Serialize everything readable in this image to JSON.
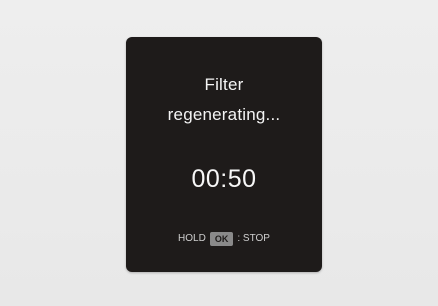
{
  "screen": {
    "title_line1": "Filter",
    "title_line2": "regenerating...",
    "timer": "00:50",
    "hint_prefix": "HOLD",
    "hint_key": "OK",
    "hint_suffix": ": STOP"
  },
  "colors": {
    "panel": "#1e1b1a",
    "background": "#ebebeb",
    "text": "#f2f2f2",
    "key_badge": "#8a8a8a"
  }
}
